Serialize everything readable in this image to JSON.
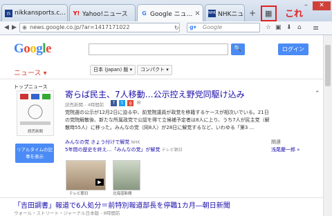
{
  "tabs": [
    {
      "label": "nikkansports.c...",
      "icon": "nikkansports-icon"
    },
    {
      "label": "Yahoo!ニュース",
      "icon": "yahoo-icon"
    },
    {
      "label": "Google ニュ...",
      "icon": "google-icon"
    },
    {
      "label": "NHKニュース",
      "icon": "nhk-icon"
    }
  ],
  "new_tab": "+",
  "url": "news.google.co.jp/?ar=1417171022",
  "search_placeholder": "Google",
  "annotation": "これ",
  "google": {
    "logo": "Google",
    "login": "ログイン"
  },
  "section": "ニュース ▾",
  "edition": "日本 (Japan) 版 ▾",
  "view": "コンパクト ▾",
  "top_news": "トップニュース",
  "article": {
    "headline": "寄らば民主、7人移動…公示控え野党同駆け込み",
    "source": "読売新聞 - 4時間前",
    "body": "党院選の公示が12月2日に迫る中、前党院議員が政党を移籍するケースが相次いでいる。21日の党院解散後、新たな所属政党で公認を得て立候補予定者は8人に上り、うち7人が民主党（解散時55人）に移った。みんなの党（同8人）が28日に解党するなど、いわゆる「第3 ...",
    "thumb_caption": "読売新聞",
    "realtime": "リアルタイムの記事を表示",
    "related_a": "みんなの党 きょう付けで解党",
    "related_a_src": "NHK",
    "related_b": "5年間の歴史を終え…「みんなの党」が解党",
    "related_b_src": "テレビ朝日",
    "related_label": "関連",
    "related_person": "浅尾慶一郎 »",
    "img1_caption": "テレビ朝日",
    "img2_caption": "北海道新聞"
  },
  "article2": {
    "headline": "「吉田調書」報道で6人処分＝前特別報道部長を停職1カ月―朝日新聞",
    "source": "ウォール・ストリート・ジャーナル日本版 - 8時間前"
  }
}
